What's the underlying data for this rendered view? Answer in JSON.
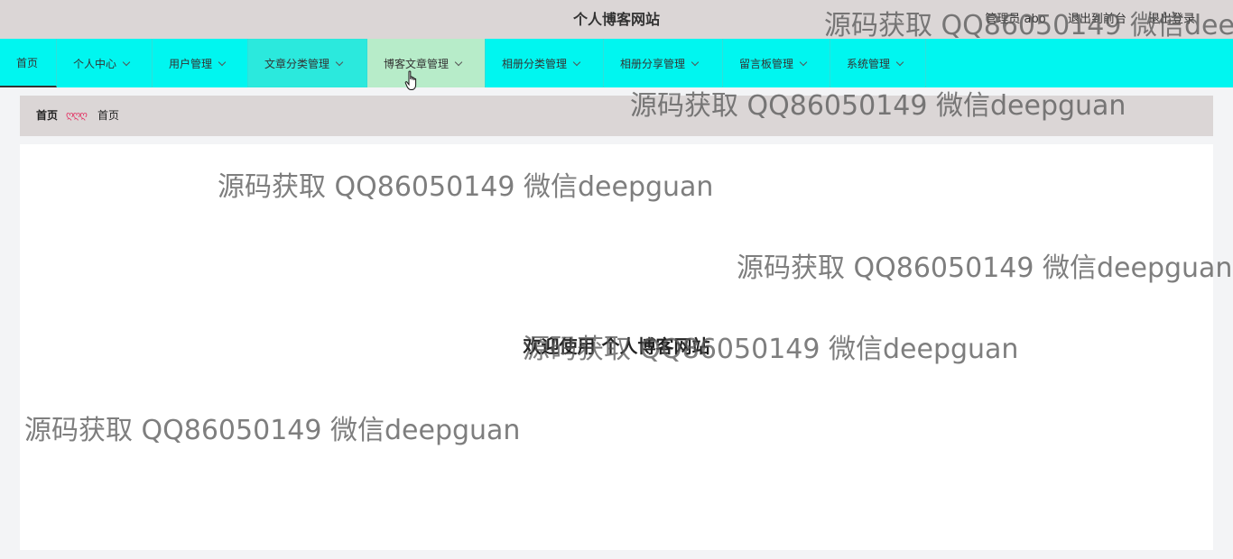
{
  "header": {
    "site_title": "个人博客网站",
    "admin_label": "管理员 abo",
    "to_frontend": "退出到前台",
    "logout": "退出登录"
  },
  "nav": {
    "items": [
      {
        "label": "首页"
      },
      {
        "label": "个人中心"
      },
      {
        "label": "用户管理"
      },
      {
        "label": "文章分类管理"
      },
      {
        "label": "博客文章管理"
      },
      {
        "label": "相册分类管理"
      },
      {
        "label": "相册分享管理"
      },
      {
        "label": "留言板管理"
      },
      {
        "label": "系统管理"
      }
    ]
  },
  "breadcrumb": {
    "home": "首页",
    "separator": "ღღღ",
    "current": "首页"
  },
  "main": {
    "welcome": "欢迎使用 个人博客网站"
  },
  "watermark": {
    "text": "源码获取 QQ86050149 微信deepguan"
  },
  "colors": {
    "topbar": "#dbd6d6",
    "navbar": "#00f6f0",
    "nav_hover": "#b7ecc9",
    "separator": "#e23c6a"
  }
}
